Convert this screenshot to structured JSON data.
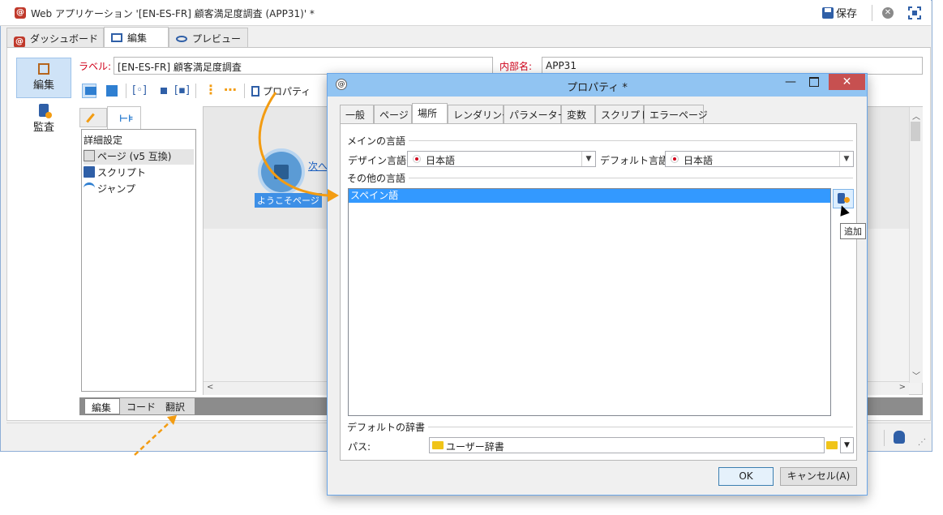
{
  "app": {
    "title": "Web アプリケーション '[EN-ES-FR] 顧客満足度調査 (APP31)' *",
    "save_label": "保存"
  },
  "top_tabs": [
    {
      "label": "ダッシュボード"
    },
    {
      "label": "編集"
    },
    {
      "label": "プレビュー"
    }
  ],
  "nav": {
    "edit_label": "編集",
    "audit_label": "監査"
  },
  "form": {
    "label_caption": "ラベル:",
    "label_value": "[EN-ES-FR] 顧客満足度調査",
    "internal_caption": "内部名:",
    "internal_value": "APP31"
  },
  "toolbar": {
    "properties_label": "プロパティ"
  },
  "tree": {
    "items": [
      {
        "label": "詳細設定"
      },
      {
        "label": "ページ (v5 互換)"
      },
      {
        "label": "スクリプト"
      },
      {
        "label": "ジャンプ"
      }
    ]
  },
  "canvas": {
    "node_label": "ようこそページ",
    "next_link": "次へ"
  },
  "bottom_tabs": [
    {
      "label": "編集"
    },
    {
      "label": "コード"
    },
    {
      "label": "翻訳"
    }
  ],
  "dialog": {
    "title": "プロパティ *",
    "tabs": [
      {
        "label": "一般"
      },
      {
        "label": "ページ"
      },
      {
        "label": "場所"
      },
      {
        "label": "レンダリング"
      },
      {
        "label": "パラメーター"
      },
      {
        "label": "変数"
      },
      {
        "label": "スクリプト"
      },
      {
        "label": "エラーページ"
      }
    ],
    "main_lang_group": "メインの言語",
    "design_lang_label": "デザイン言語:",
    "design_lang_value": "日本語",
    "default_lang_label": "デフォルト言語:",
    "default_lang_value": "日本語",
    "other_lang_group": "その他の言語",
    "other_languages": [
      "スペイン語"
    ],
    "add_tooltip": "追加",
    "dict_group": "デフォルトの辞書",
    "path_label": "パス:",
    "path_value": "ユーザー辞書",
    "ok_label": "OK",
    "cancel_label": "キャンセル(A)"
  },
  "colors": {
    "accent": "#3399ff",
    "annotation_arrow": "#f39c12",
    "dialog_titlebar": "#91c4f2",
    "required_label": "#d0021b"
  }
}
